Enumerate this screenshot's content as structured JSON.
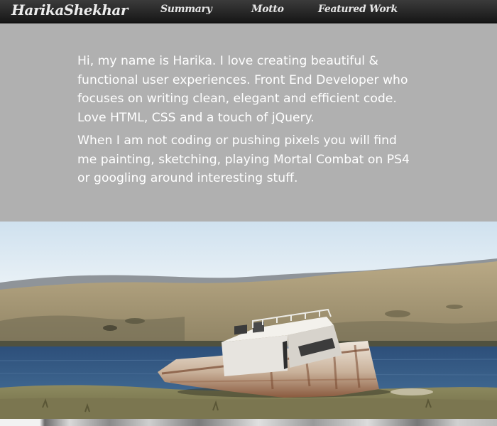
{
  "nav": {
    "brand": "HarikaShekhar",
    "links": [
      {
        "label": "Summary"
      },
      {
        "label": "Motto"
      },
      {
        "label": "Featured Work"
      }
    ]
  },
  "intro": {
    "paragraphs": [
      "Hi, my name is Harika. I love creating beautiful & functional user experiences. Front End Developer who focuses on writing clean, elegant and efficient code. Love HTML, CSS and a touch of jQuery.",
      "When I am not coding or pushing pixels you will find me painting, sketching, playing Mortal Combat on PS4 or googling around interesting stuff."
    ]
  },
  "colors": {
    "nav_background": "#222222",
    "intro_background": "#b0b0b0",
    "intro_text": "#ffffff"
  }
}
